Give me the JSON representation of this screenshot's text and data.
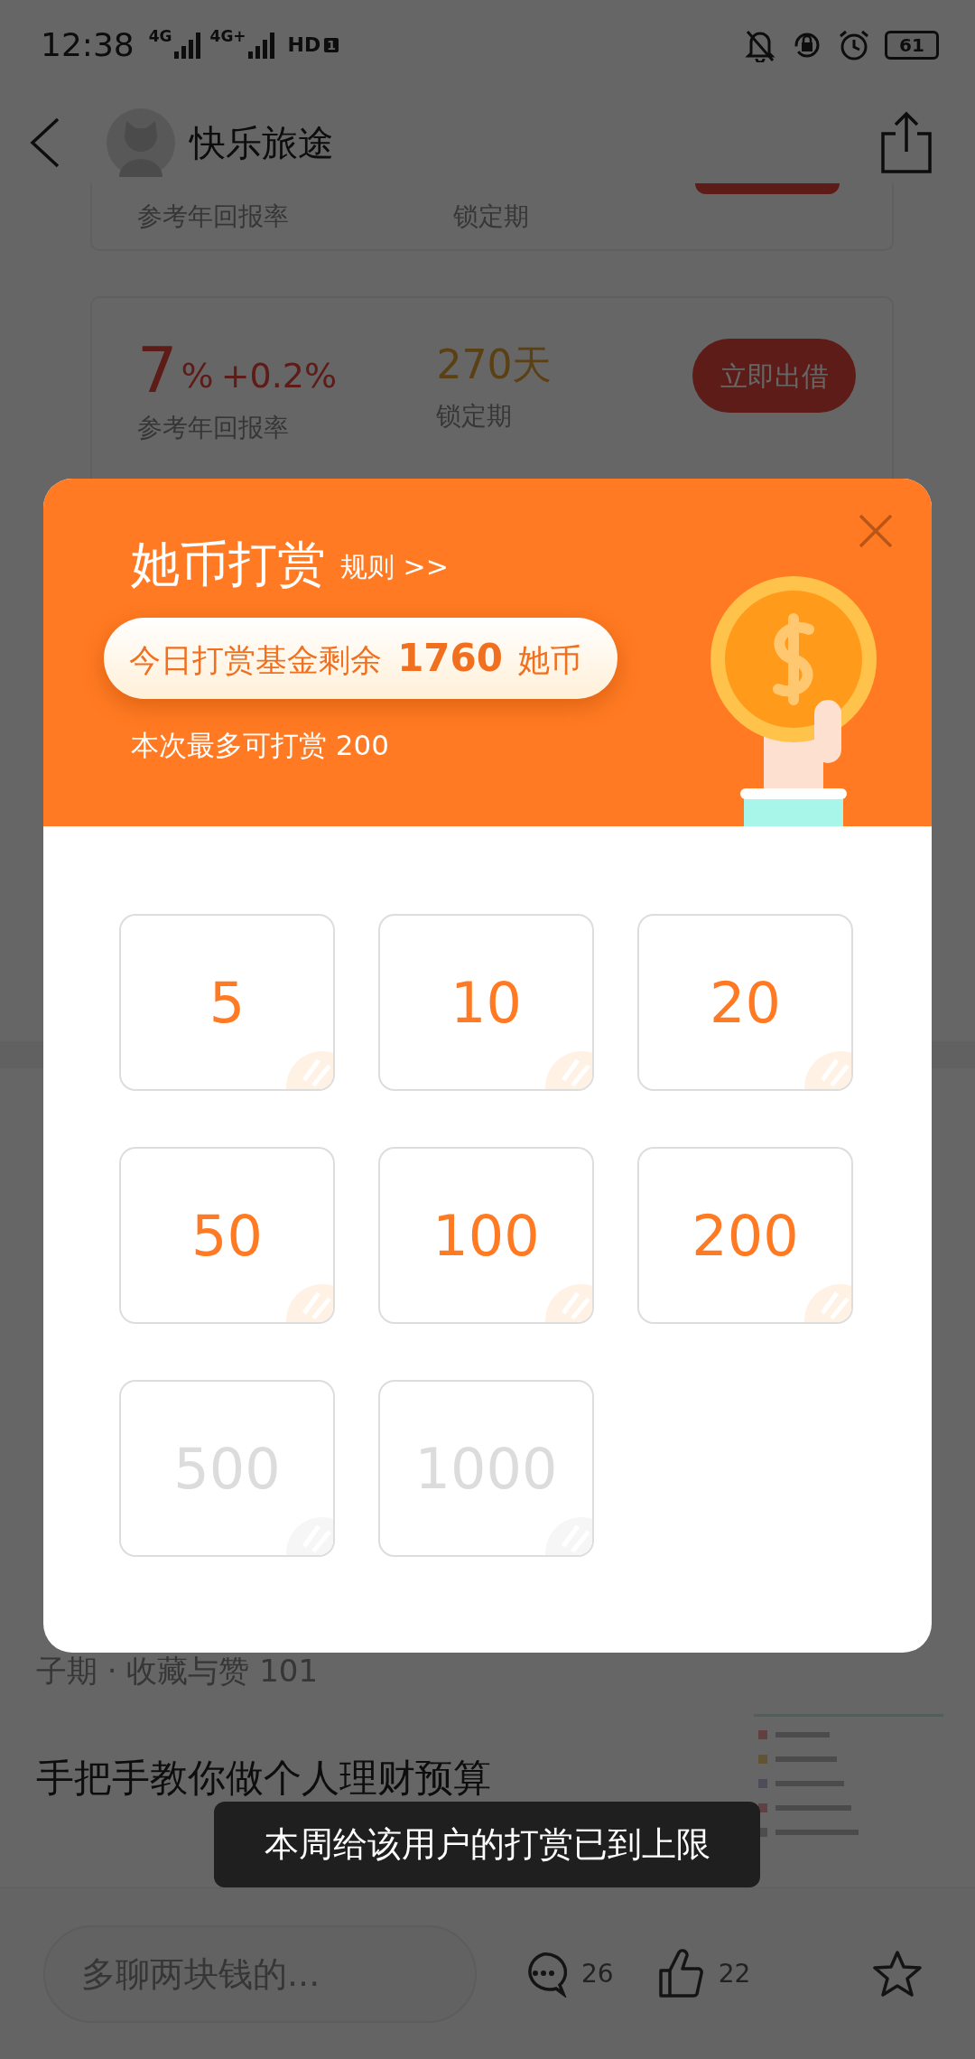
{
  "status_bar": {
    "time": "12:38",
    "networks": [
      {
        "label": "4G"
      },
      {
        "label": "4G+"
      }
    ],
    "hd_label": "HD",
    "hd_sim": "1",
    "battery": "61"
  },
  "header": {
    "title": "快乐旅途"
  },
  "products": [
    {
      "kind": "cut",
      "rate_label": "参考年回报率",
      "period_label": "锁定期"
    },
    {
      "kind": "full",
      "rate": "7",
      "rate_unit": "%",
      "bonus": "+0.2%",
      "period": "270天",
      "rate_label": "参考年回报率",
      "period_label": "锁定期",
      "button": "立即出借"
    }
  ],
  "articles": [
    {
      "meta": "子期 · 收藏与赞 101"
    },
    {
      "title": "手把手教你做个人理财预算"
    }
  ],
  "bottom_bar": {
    "placeholder": "多聊两块钱的...",
    "comments": "26",
    "likes": "22"
  },
  "reward_dialog": {
    "title": "她币打赏",
    "rules_link": "规则 >>",
    "fund": "今日打赏基金剩余 **1760** 她币",
    "max_note": "本次最多可打赏 200",
    "amounts": [
      {
        "label": "5",
        "disabled": false
      },
      {
        "label": "10",
        "disabled": false
      },
      {
        "label": "20",
        "disabled": false
      },
      {
        "label": "50",
        "disabled": false
      },
      {
        "label": "100",
        "disabled": false
      },
      {
        "label": "200",
        "disabled": false
      },
      {
        "label": "500",
        "disabled": true
      },
      {
        "label": "1000",
        "disabled": true
      }
    ]
  },
  "toast": "本周给该用户的打赏已到上限"
}
